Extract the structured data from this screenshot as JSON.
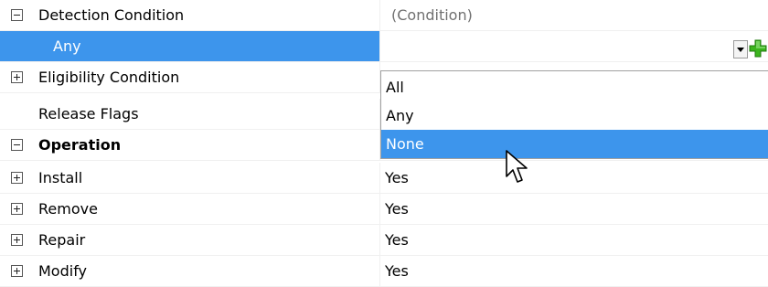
{
  "property_grid": {
    "rows": [
      {
        "label": "Detection Condition",
        "value": "(Condition)",
        "expander": "minus",
        "bold": false
      },
      {
        "label": "Any",
        "value": "",
        "expander": "none",
        "bold": false,
        "selected": true
      },
      {
        "label": "Eligibility Condition",
        "value": "",
        "expander": "plus",
        "bold": false
      },
      {
        "label": "Release Flags",
        "value": "",
        "expander": "none",
        "bold": false
      },
      {
        "label": "Operation",
        "value": "",
        "expander": "minus",
        "bold": true
      },
      {
        "label": "Install",
        "value": "Yes",
        "expander": "plus",
        "bold": false
      },
      {
        "label": "Remove",
        "value": "Yes",
        "expander": "plus",
        "bold": false
      },
      {
        "label": "Repair",
        "value": "Yes",
        "expander": "plus",
        "bold": false
      },
      {
        "label": "Modify",
        "value": "Yes",
        "expander": "plus",
        "bold": false
      }
    ]
  },
  "dropdown": {
    "options": [
      "All",
      "Any",
      "None"
    ],
    "highlighted": "None"
  },
  "icons": {
    "dropdown_button": "chevron-down-icon",
    "add_button": "green-plus-icon",
    "cursor": "mouse-pointer-icon"
  },
  "colors": {
    "selection": "#3d95ec",
    "add_icon": "#3cb41e"
  }
}
